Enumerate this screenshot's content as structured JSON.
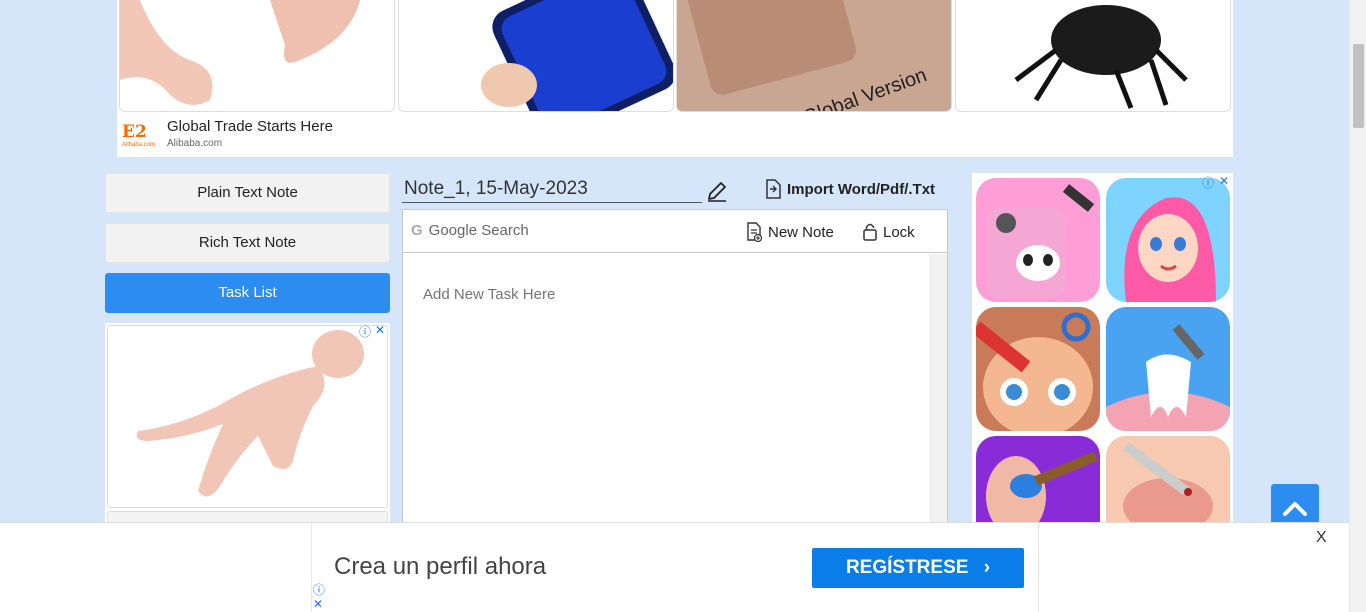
{
  "top_ad": {
    "brand_title": "Global Trade Starts Here",
    "brand_sub": "Alibaba.com",
    "logo_text": "E2",
    "logo_small": "Alibaba.com",
    "product3_text": "Global Version"
  },
  "nav": {
    "plain_text_note": "Plain Text Note",
    "rich_text_note": "Rich Text Note",
    "task_list": "Task List"
  },
  "note": {
    "title": "Note_1, 15-May-2023",
    "import_label": "Import Word/Pdf/.Txt",
    "google_search": "Google Search",
    "google_letter": "G",
    "new_note": "New Note",
    "lock": "Lock",
    "task_placeholder": "Add New Task Here"
  },
  "bottom_ad": {
    "promo": "Crea un perfil ahora",
    "cta": "REGÍSTRESE",
    "close": "X"
  },
  "colors": {
    "accent": "#2d8cf0",
    "page_bg": "#d5e6fb",
    "cta_bg": "#0b7de8"
  }
}
